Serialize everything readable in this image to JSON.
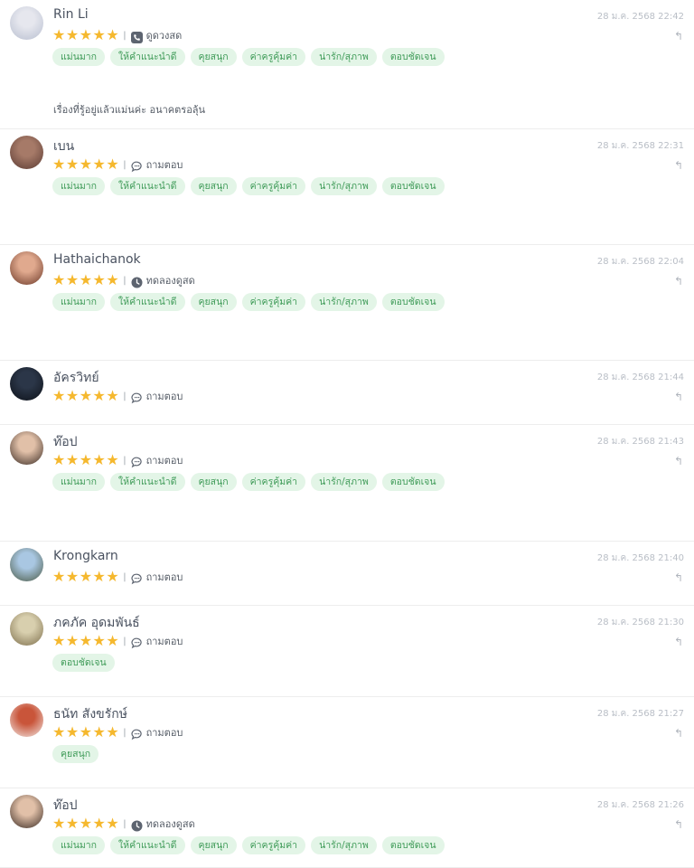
{
  "colors": {
    "star": "#f5b82e",
    "tag_bg": "#e3f5e7",
    "tag_text": "#3f9b58"
  },
  "reviews": [
    {
      "name": "Rin Li",
      "time": "28 ม.ค. 2568 22:42",
      "rating": 5,
      "service_icon": "phone-icon",
      "service": "ดูดวงสด",
      "tags": [
        "แม่นมาก",
        "ให้คำแนะนำดี",
        "คุยสนุก",
        "ค่าครูคุ้มค่า",
        "น่ารัก/สุภาพ",
        "ตอบชัดเจน"
      ],
      "comment": "เรื่องที่รู้อยู่แล้วแม่นค่ะ อนาคตรอลุ้น",
      "avatar_colors": [
        "#e6e7ee",
        "#b8bfd0"
      ]
    },
    {
      "name": "เบน",
      "time": "28 ม.ค. 2568 22:31",
      "rating": 5,
      "service_icon": "chat-icon",
      "service": "ถามตอบ",
      "tags": [
        "แม่นมาก",
        "ให้คำแนะนำดี",
        "คุยสนุก",
        "ค่าครูคุ้มค่า",
        "น่ารัก/สุภาพ",
        "ตอบชัดเจน"
      ],
      "comment": "",
      "avatar_colors": [
        "#a67a68",
        "#5b3b33"
      ]
    },
    {
      "name": "Hathaichanok",
      "time": "28 ม.ค. 2568 22:04",
      "rating": 5,
      "service_icon": "clock-icon",
      "service": "ทดลองดูสด",
      "tags": [
        "แม่นมาก",
        "ให้คำแนะนำดี",
        "คุยสนุก",
        "ค่าครูคุ้มค่า",
        "น่ารัก/สุภาพ",
        "ตอบชัดเจน"
      ],
      "comment": "",
      "avatar_colors": [
        "#e0a98e",
        "#6b3828"
      ]
    },
    {
      "name": "อัครวิทย์",
      "time": "28 ม.ค. 2568 21:44",
      "rating": 5,
      "service_icon": "chat-icon",
      "service": "ถามตอบ",
      "tags": [],
      "comment": "",
      "avatar_colors": [
        "#2b3648",
        "#0d1118"
      ]
    },
    {
      "name": "ท๊อป",
      "time": "28 ม.ค. 2568 21:43",
      "rating": 5,
      "service_icon": "chat-icon",
      "service": "ถามตอบ",
      "tags": [
        "แม่นมาก",
        "ให้คำแนะนำดี",
        "คุยสนุก",
        "ค่าครูคุ้มค่า",
        "น่ารัก/สุภาพ",
        "ตอบชัดเจน"
      ],
      "comment": "",
      "avatar_colors": [
        "#e1c0a8",
        "#3a2b24"
      ]
    },
    {
      "name": "Krongkarn",
      "time": "28 ม.ค. 2568 21:40",
      "rating": 5,
      "service_icon": "chat-icon",
      "service": "ถามตอบ",
      "tags": [],
      "comment": "",
      "avatar_colors": [
        "#a9c7e2",
        "#4b5a45"
      ]
    },
    {
      "name": "ภคภัค อุดมพันธ์",
      "time": "28 ม.ค. 2568 21:30",
      "rating": 5,
      "service_icon": "chat-icon",
      "service": "ถามตอบ",
      "tags": [
        "ตอบชัดเจน"
      ],
      "comment": "",
      "avatar_colors": [
        "#d8cfae",
        "#7d6e4c"
      ]
    },
    {
      "name": "ธนัท สังขรักษ์",
      "time": "28 ม.ค. 2568 21:27",
      "rating": 5,
      "service_icon": "chat-icon",
      "service": "ถามตอบ",
      "tags": [
        "คุยสนุก"
      ],
      "comment": "",
      "avatar_colors": [
        "#c9553a",
        "#f1e8e4"
      ]
    },
    {
      "name": "ท๊อป",
      "time": "28 ม.ค. 2568 21:26",
      "rating": 5,
      "service_icon": "clock-icon",
      "service": "ทดลองดูสด",
      "tags": [
        "แม่นมาก",
        "ให้คำแนะนำดี",
        "คุยสนุก",
        "ค่าครูคุ้มค่า",
        "น่ารัก/สุภาพ",
        "ตอบชัดเจน"
      ],
      "comment": "",
      "avatar_colors": [
        "#e1c0a8",
        "#3a2b24"
      ]
    }
  ]
}
